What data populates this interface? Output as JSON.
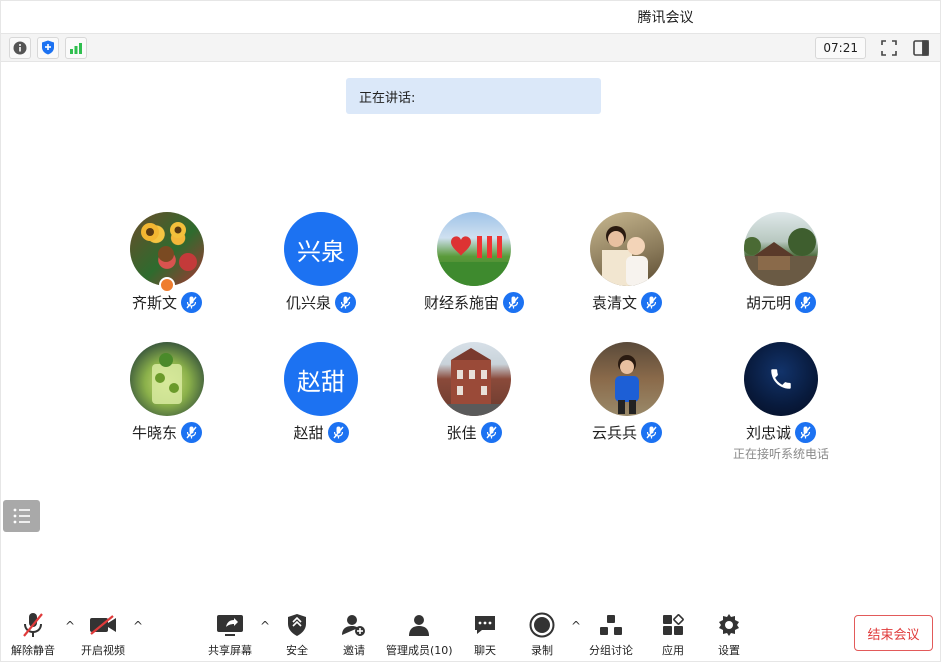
{
  "window": {
    "title": "腾讯会议"
  },
  "status": {
    "timer": "07:21"
  },
  "speaking": {
    "label": "正在讲话:"
  },
  "participants": [
    {
      "name": "齐斯文",
      "avatar": "photo-flowers"
    },
    {
      "name": "仉兴泉",
      "avatar": "text",
      "initials": "兴泉"
    },
    {
      "name": "财经系施宙",
      "avatar": "photo-garden"
    },
    {
      "name": "袁清文",
      "avatar": "photo-mother-baby"
    },
    {
      "name": "胡元明",
      "avatar": "photo-building"
    },
    {
      "name": "牛晓东",
      "avatar": "photo-drink"
    },
    {
      "name": "赵甜",
      "avatar": "text",
      "initials": "赵甜"
    },
    {
      "name": "张佳",
      "avatar": "photo-redbrick"
    },
    {
      "name": "云兵兵",
      "avatar": "photo-child"
    },
    {
      "name": "刘忠诚",
      "avatar": "phone",
      "status": "正在接听系统电话"
    }
  ],
  "toolbar": {
    "unmute": "解除静音",
    "start_video": "开启视频",
    "share_screen": "共享屏幕",
    "security": "安全",
    "invite": "邀请",
    "members": "管理成员(10)",
    "chat": "聊天",
    "record": "录制",
    "breakout": "分组讨论",
    "apps": "应用",
    "settings": "设置",
    "end": "结束会议"
  },
  "colors": {
    "accent": "#1c72f2",
    "end": "#e03b3b",
    "signal": "#2fbf4f"
  }
}
